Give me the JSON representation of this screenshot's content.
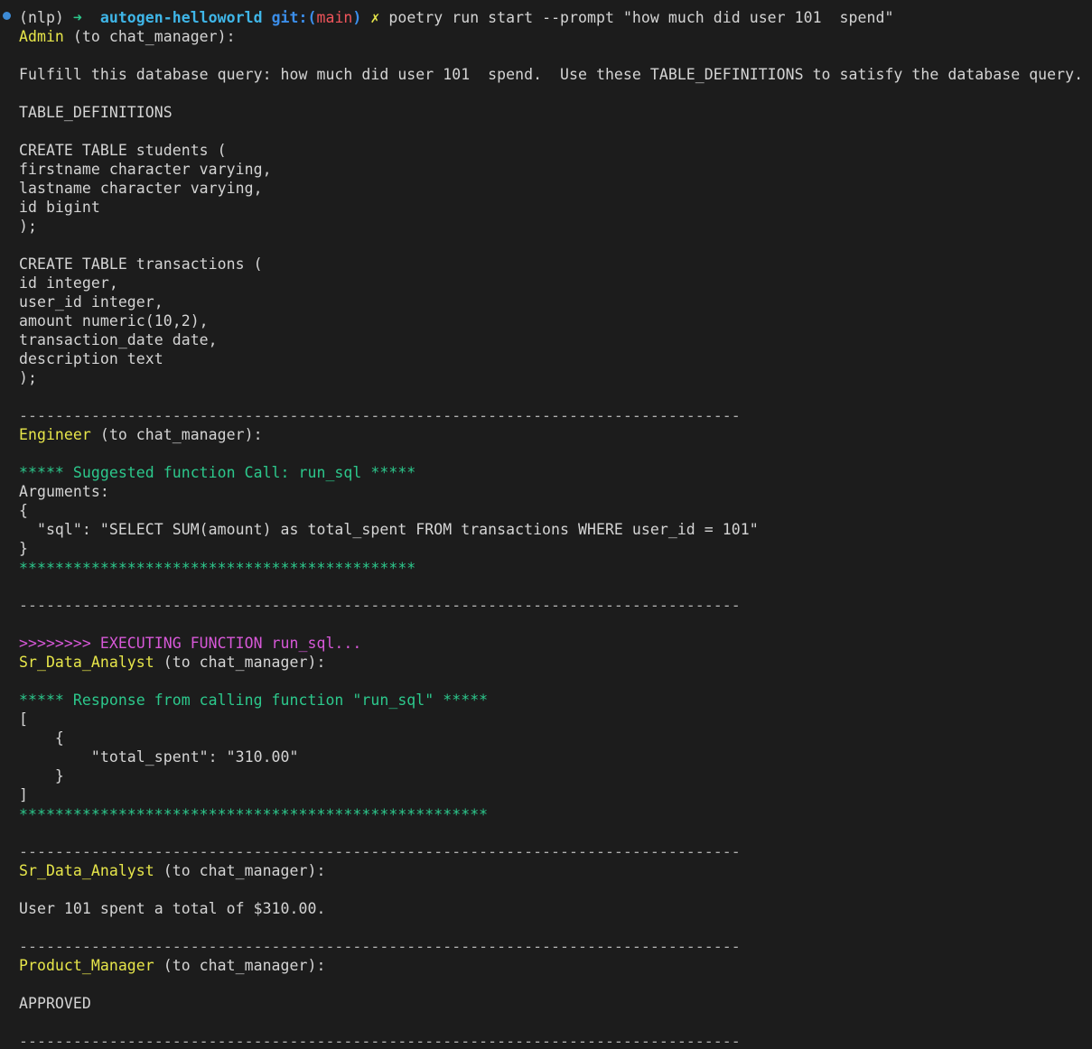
{
  "prompt": {
    "env": "(nlp)",
    "arrow": "➜",
    "dir": "autogen-helloworld",
    "git_prefix": "git:(",
    "branch": "main",
    "git_suffix": ")",
    "dirty_mark": "✗",
    "command": "poetry run start --prompt \"how much did user 101  spend\""
  },
  "separator": "--------------------------------------------------------------------------------",
  "to_chat_manager": "(to chat_manager):",
  "admin": {
    "speaker": "Admin",
    "query_line": "Fulfill this database query: how much did user 101  spend.  Use these TABLE_DEFINITIONS to satisfy the database query.",
    "table_defs_label": "TABLE_DEFINITIONS",
    "students_table": [
      "CREATE TABLE students (",
      "firstname character varying,",
      "lastname character varying,",
      "id bigint",
      ");"
    ],
    "transactions_table": [
      "CREATE TABLE transactions (",
      "id integer,",
      "user_id integer,",
      "amount numeric(10,2),",
      "transaction_date date,",
      "description text",
      ");"
    ]
  },
  "engineer": {
    "speaker": "Engineer",
    "suggested_call": "***** Suggested function Call: run_sql *****",
    "arguments_label": "Arguments:",
    "open_brace": "{",
    "sql_line": "  \"sql\": \"SELECT SUM(amount) as total_spent FROM transactions WHERE user_id = 101\"",
    "close_brace": "}",
    "stars": "********************************************"
  },
  "execution": {
    "executing": ">>>>>>>> EXECUTING FUNCTION run_sql...",
    "speaker": "Sr_Data_Analyst",
    "response_header": "***** Response from calling function \"run_sql\" *****",
    "response_lines": [
      "[",
      "    {",
      "        \"total_spent\": \"310.00\"",
      "    }",
      "]"
    ],
    "stars": "****************************************************"
  },
  "analyst_reply": {
    "speaker": "Sr_Data_Analyst",
    "message": "User 101 spent a total of $310.00."
  },
  "product_manager": {
    "speaker": "Product_Manager",
    "message": "APPROVED"
  },
  "colors": {
    "background": "#1c1c1c",
    "text": "#d4d4d4",
    "speaker_yellow": "#e7e64a",
    "function_green": "#2cc88c",
    "executing_magenta": "#d758d8",
    "dir_cyan": "#3fb6e8",
    "branch_red": "#f1555b",
    "status_dot_blue": "#3d8bd6"
  }
}
